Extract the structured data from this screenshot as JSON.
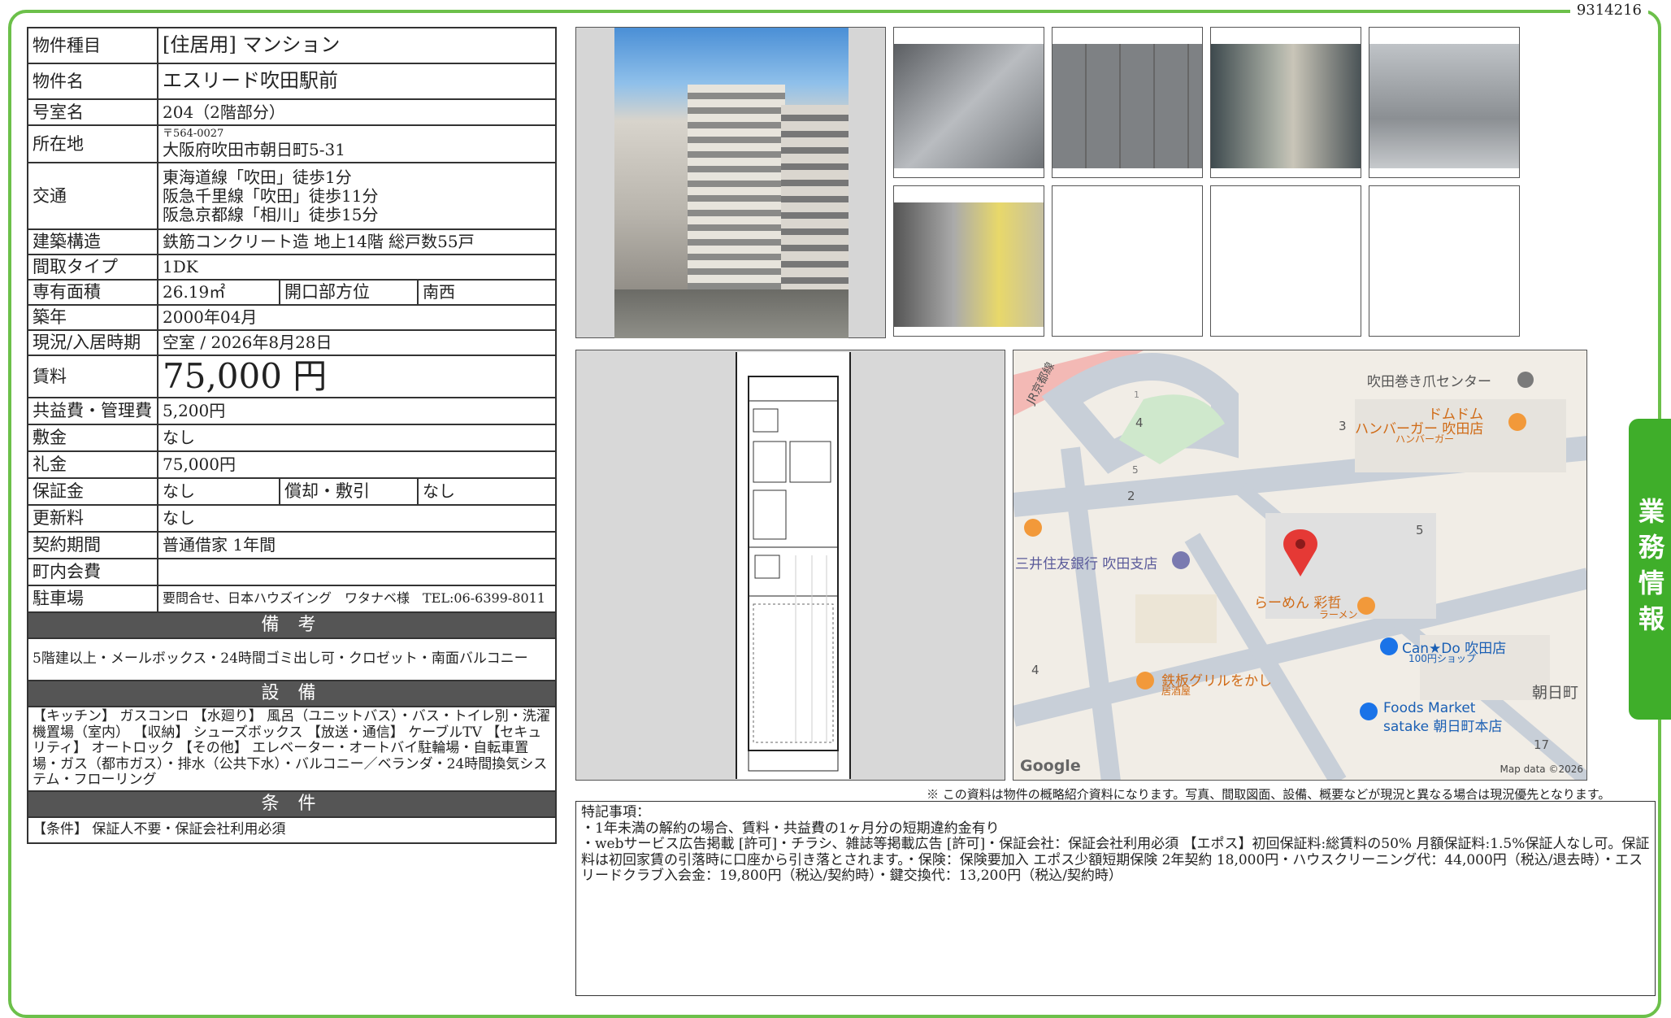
{
  "doc_id": "9314216",
  "side_tab": "業務情報",
  "rows": {
    "type_k": "物件種目",
    "type_v": "[住居用]  マンション",
    "name_k": "物件名",
    "name_v": "エスリード吹田駅前",
    "room_k": "号室名",
    "room_v": "204（2階部分）",
    "addr_k": "所在地",
    "addr_zip": "〒564-0027",
    "addr_v": "大阪府吹田市朝日町5-31",
    "traffic_k": "交通",
    "traffic_1": "東海道線「吹田」徒歩1分",
    "traffic_2": "阪急千里線「吹田」徒歩11分",
    "traffic_3": "阪急京都線「相川」徒歩15分",
    "struct_k": "建築構造",
    "struct_v": "鉄筋コンクリート造 地上14階 総戸数55戸",
    "layout_k": "間取タイプ",
    "layout_v": "1DK",
    "area_k": "専有面積",
    "area_v": "26.19㎡",
    "dir_k": "開口部方位",
    "dir_v": "南西",
    "built_k": "築年",
    "built_v": "2000年04月",
    "status_k": "現況/入居時期",
    "status_v": "空室  /  2026年8月28日",
    "rent_k": "賃料",
    "rent_v": "75,000 円",
    "fee_k": "共益費・管理費",
    "fee_v": "5,200円",
    "deposit_k": "敷金",
    "deposit_v": "なし",
    "key_k": "礼金",
    "key_v": "75,000円",
    "guar_k": "保証金",
    "guar_v": "なし",
    "amort_k": "償却・敷引",
    "amort_v": "なし",
    "renew_k": "更新料",
    "renew_v": "なし",
    "contract_k": "契約期間",
    "contract_v": "普通借家 1年間",
    "town_k": "町内会費",
    "town_v": "",
    "parking_k": "駐車場",
    "parking_v": "要問合せ、日本ハウズイング　ワタナベ様　TEL:06-6399-8011"
  },
  "notes_title": "備  考",
  "notes": "5階建以上・メールボックス・24時間ゴミ出し可・クロゼット・南面バルコニー",
  "equip_title": "設  備",
  "equip": "【キッチン】 ガスコンロ 【水廻り】 風呂（ユニットバス）・バス・トイレ別・洗濯機置場（室内） 【収納】 シューズボックス 【放送・通信】 ケーブルTV 【セキュリティ】 オートロック 【その他】 エレベーター・オートバイ駐輪場・自転車置場・ガス（都市ガス）・排水（公共下水）・バルコニー／ベランダ・24時間換気システム・フローリング",
  "cond_title": "条  件",
  "cond": "【条件】 保証人不要・保証会社利用必須",
  "map": {
    "jr": "JR京都線",
    "poi1": "吹田巻き爪センター",
    "poi2": "ドムドム",
    "poi2b": "ハンバーガー 吹田店",
    "poi2c": "ハンバーガー",
    "bank": "三井住友銀行 吹田支店",
    "ramen": "らーめん 彩哲",
    "ramen2": "ラーメン",
    "cando": "Can★Do 吹田店",
    "cando2": "100円ショップ",
    "grill": "鉄板グリルをかし",
    "grill2": "居酒屋",
    "foods": "Foods Market",
    "foods2": "satake 朝日町本店",
    "town": "朝日町",
    "google": "Google",
    "mapdata": "Map data ©2026",
    "n1": "1",
    "n2": "2",
    "n3": "3",
    "n4": "4",
    "n4b": "4",
    "n5": "5",
    "n5b": "5",
    "n17": "17"
  },
  "caption": "※ この資料は物件の概略紹介資料になります。写真、間取図面、設備、概要などが現況と異なる場合は現況優先となります。",
  "remarks": {
    "title": "特記事項：",
    "l1": "・1年未満の解約の場合、賃料・共益費の1ヶ月分の短期違約金有り",
    "l2": "・webサービス広告掲載 [許可]・チラシ、雑誌等掲載広告 [許可]・保証会社：保証会社利用必須 【エポス】初回保証料:総賃料の50% 月額保証料:1.5%保証人なし可。保証料は初回家賃の引落時に口座から引き落とされます。・保険：保険要加入 エポス少額短期保険 2年契約 18,000円・ハウスクリーニング代：44,000円（税込/退去時）・エスリードクラブ入会金：19,800円（税込/契約時）・鍵交換代：13,200円（税込/契約時）"
  }
}
